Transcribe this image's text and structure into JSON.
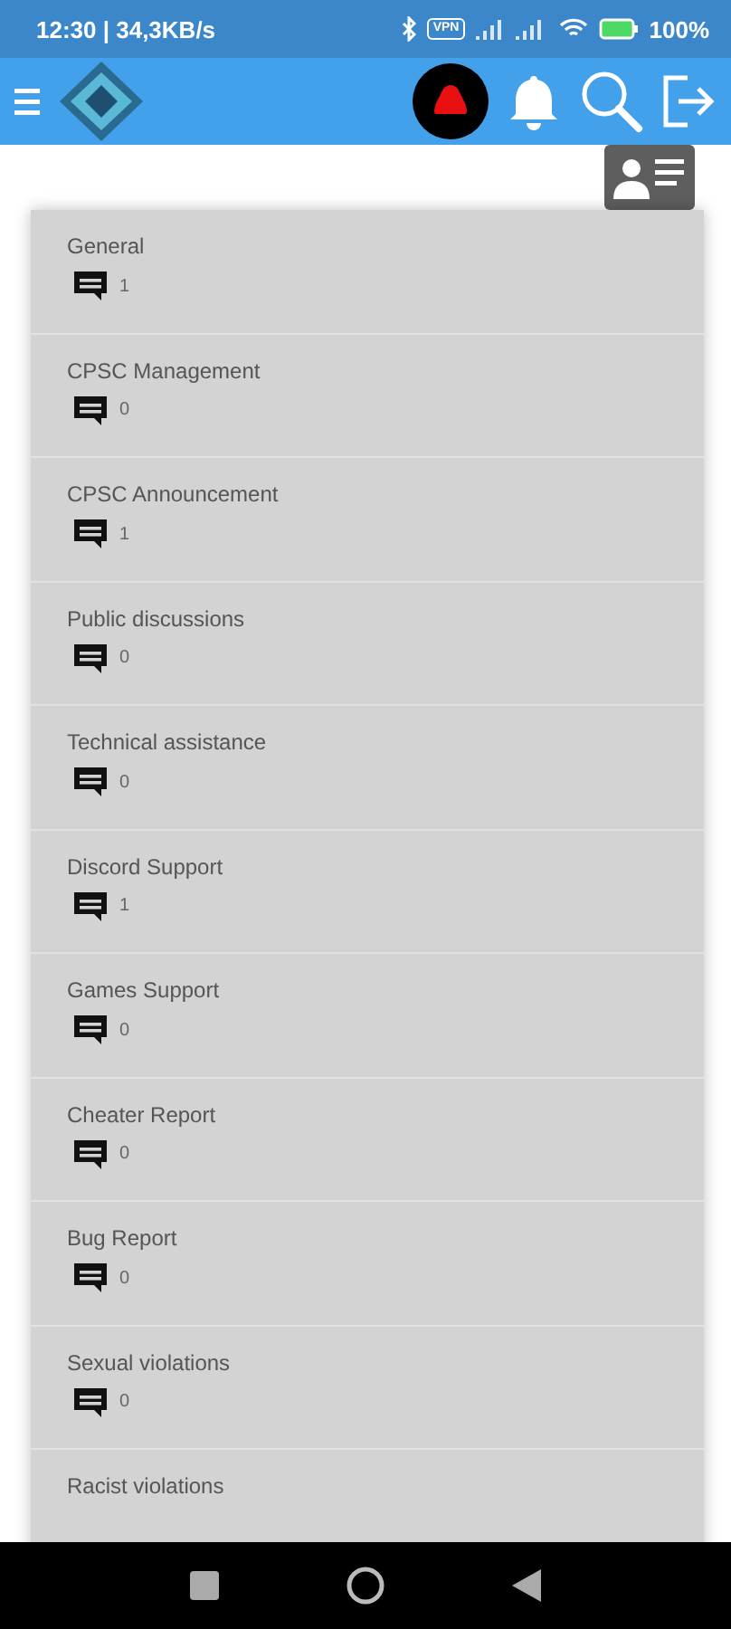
{
  "status_bar": {
    "left_text": "12:30 | 34,3KB/s",
    "vpn_badge": "VPN",
    "battery": "100%"
  },
  "forums": [
    {
      "name": "General",
      "count": "1"
    },
    {
      "name": "CPSC Management",
      "count": "0"
    },
    {
      "name": "CPSC Announcement",
      "count": "1"
    },
    {
      "name": "Public discussions",
      "count": "0"
    },
    {
      "name": "Technical assistance",
      "count": "0"
    },
    {
      "name": "Discord Support",
      "count": "1"
    },
    {
      "name": "Games Support",
      "count": "0"
    },
    {
      "name": "Cheater Report",
      "count": "0"
    },
    {
      "name": "Bug Report",
      "count": "0"
    },
    {
      "name": "Sexual violations",
      "count": "0"
    },
    {
      "name": "Racist violations"
    }
  ]
}
